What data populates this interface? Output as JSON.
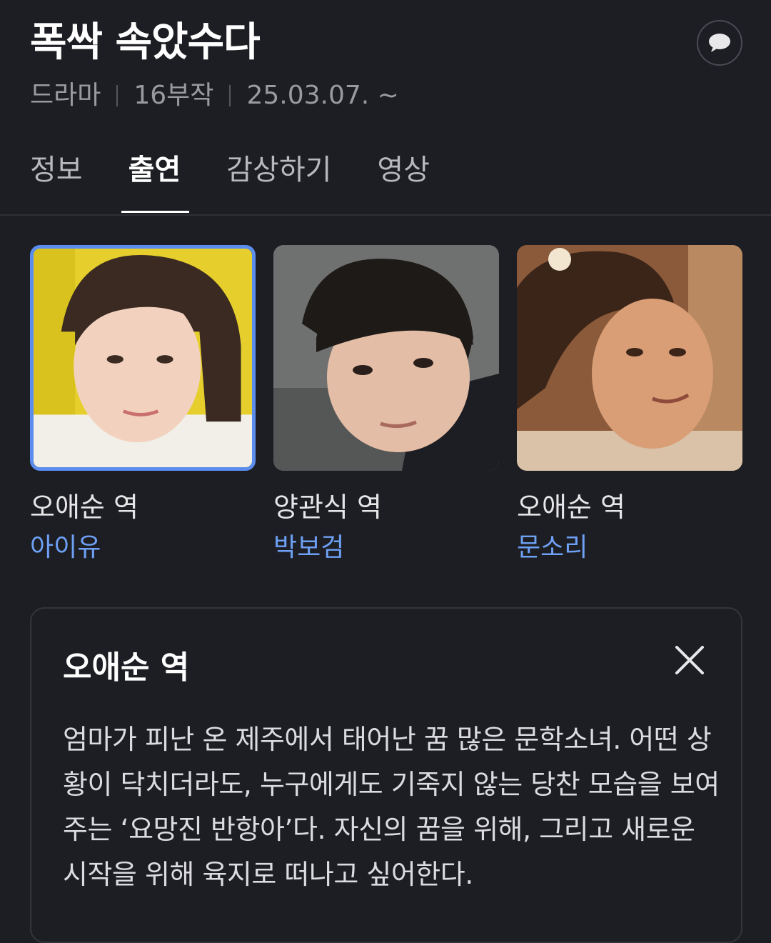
{
  "header": {
    "title": "폭싹 속았수다",
    "meta": [
      "드라마",
      "16부작",
      "25.03.07. ~"
    ]
  },
  "tabs": [
    {
      "label": "정보",
      "active": false
    },
    {
      "label": "출연",
      "active": true
    },
    {
      "label": "감상하기",
      "active": false
    },
    {
      "label": "영상",
      "active": false
    }
  ],
  "cast": [
    {
      "role": "오애순 역",
      "actor": "아이유",
      "selected": true
    },
    {
      "role": "양관식 역",
      "actor": "박보검",
      "selected": false
    },
    {
      "role": "오애순 역",
      "actor": "문소리",
      "selected": false
    }
  ],
  "detail": {
    "title": "오애순 역",
    "description": "엄마가 피난 온 제주에서 태어난 꿈 많은 문학소녀. 어떤 상황이 닥치더라도, 누구에게도 기죽지 않는 당찬 모습을 보여주는 ‘요망진 반항아’다. 자신의 꿈을 위해, 그리고 새로운 시작을 위해 육지로 떠나고 싶어한다."
  },
  "colors": {
    "background": "#1d1e23",
    "accent_link": "#6ea0f5",
    "selected_border": "#5b8def"
  },
  "icons": {
    "comment": "speech-bubble-icon",
    "close": "close-icon"
  }
}
